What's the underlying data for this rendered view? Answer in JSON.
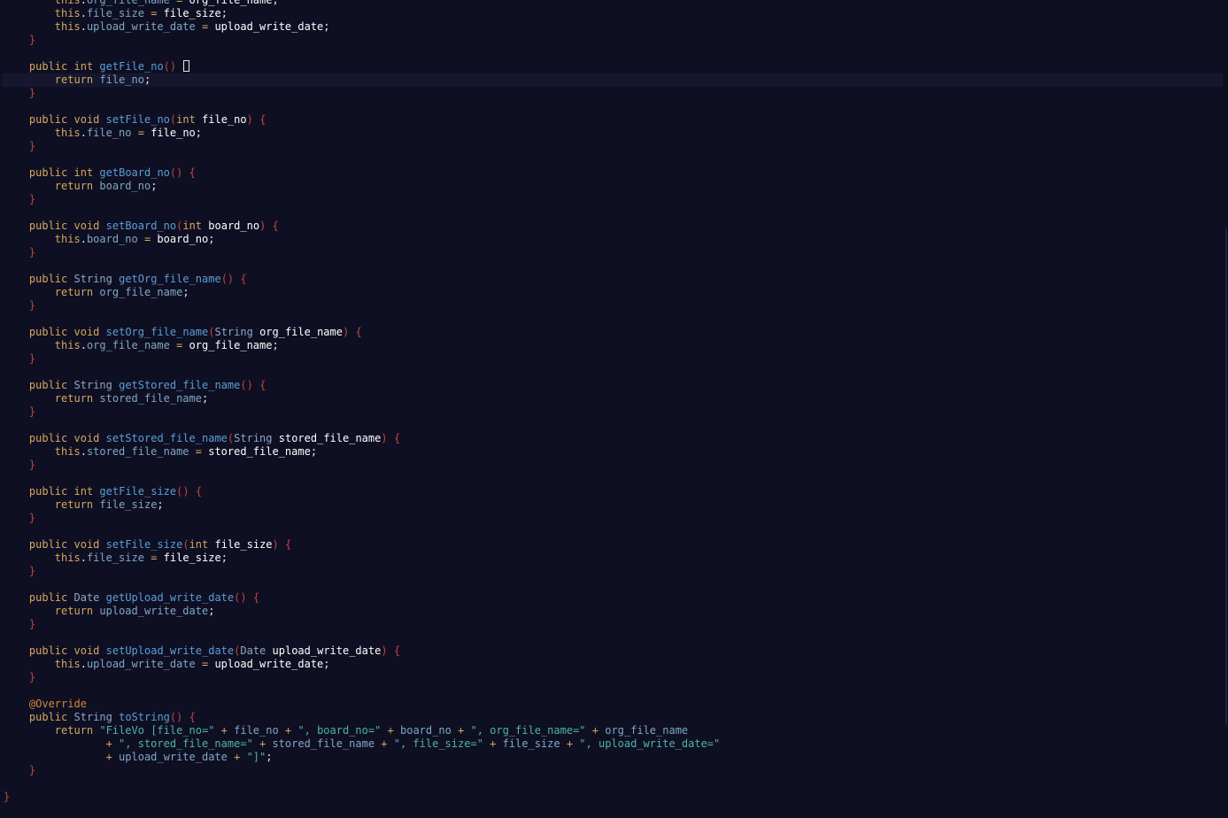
{
  "editor": {
    "theme_colors": {
      "background": "#0f0f23",
      "keyword": "#d4a85c",
      "type": "#8fa6c4",
      "method": "#5a9fd4",
      "field": "#7ea8c6",
      "brace": "#c4453a",
      "annotation": "#d4883c",
      "string": "#4fb3a9"
    },
    "current_line_index": 6,
    "lines": [
      [
        [
          "        ",
          "pl"
        ],
        [
          "this",
          "kw"
        ],
        [
          ".",
          "pl"
        ],
        [
          "org_file_name",
          "fld"
        ],
        [
          " = ",
          "op"
        ],
        [
          "org_file_name",
          "par"
        ],
        [
          ";",
          "pl"
        ]
      ],
      [
        [
          "        ",
          "pl"
        ],
        [
          "this",
          "kw"
        ],
        [
          ".",
          "pl"
        ],
        [
          "file_size",
          "fld"
        ],
        [
          " = ",
          "op"
        ],
        [
          "file_size",
          "par"
        ],
        [
          ";",
          "pl"
        ]
      ],
      [
        [
          "        ",
          "pl"
        ],
        [
          "this",
          "kw"
        ],
        [
          ".",
          "pl"
        ],
        [
          "upload_write_date",
          "fld"
        ],
        [
          " = ",
          "op"
        ],
        [
          "upload_write_date",
          "par"
        ],
        [
          ";",
          "pl"
        ]
      ],
      [
        [
          "    ",
          "pl"
        ],
        [
          "}",
          "brc"
        ]
      ],
      [
        [
          "",
          "pl"
        ]
      ],
      [
        [
          "    ",
          "pl"
        ],
        [
          "public",
          "kw"
        ],
        [
          " ",
          "pl"
        ],
        [
          "int",
          "kw"
        ],
        [
          " ",
          "pl"
        ],
        [
          "getFile_no",
          "fn"
        ],
        [
          "()",
          "brc"
        ],
        [
          " ",
          "pl"
        ],
        [
          "{CARET}",
          "caret"
        ]
      ],
      [
        [
          "        ",
          "pl"
        ],
        [
          "return",
          "kw"
        ],
        [
          " ",
          "pl"
        ],
        [
          "file_no",
          "fld"
        ],
        [
          ";",
          "pl"
        ]
      ],
      [
        [
          "    ",
          "pl"
        ],
        [
          "}",
          "brc"
        ]
      ],
      [
        [
          "",
          "pl"
        ]
      ],
      [
        [
          "    ",
          "pl"
        ],
        [
          "public",
          "kw"
        ],
        [
          " ",
          "pl"
        ],
        [
          "void",
          "kw"
        ],
        [
          " ",
          "pl"
        ],
        [
          "setFile_no",
          "fn"
        ],
        [
          "(",
          "brc"
        ],
        [
          "int",
          "kw"
        ],
        [
          " ",
          "pl"
        ],
        [
          "file_no",
          "par"
        ],
        [
          ")",
          "brc"
        ],
        [
          " ",
          "pl"
        ],
        [
          "{",
          "brc"
        ]
      ],
      [
        [
          "        ",
          "pl"
        ],
        [
          "this",
          "kw"
        ],
        [
          ".",
          "pl"
        ],
        [
          "file_no",
          "fld"
        ],
        [
          " = ",
          "op"
        ],
        [
          "file_no",
          "par"
        ],
        [
          ";",
          "pl"
        ]
      ],
      [
        [
          "    ",
          "pl"
        ],
        [
          "}",
          "brc"
        ]
      ],
      [
        [
          "",
          "pl"
        ]
      ],
      [
        [
          "    ",
          "pl"
        ],
        [
          "public",
          "kw"
        ],
        [
          " ",
          "pl"
        ],
        [
          "int",
          "kw"
        ],
        [
          " ",
          "pl"
        ],
        [
          "getBoard_no",
          "fn"
        ],
        [
          "()",
          "brc"
        ],
        [
          " ",
          "pl"
        ],
        [
          "{",
          "brc"
        ]
      ],
      [
        [
          "        ",
          "pl"
        ],
        [
          "return",
          "kw"
        ],
        [
          " ",
          "pl"
        ],
        [
          "board_no",
          "fld"
        ],
        [
          ";",
          "pl"
        ]
      ],
      [
        [
          "    ",
          "pl"
        ],
        [
          "}",
          "brc"
        ]
      ],
      [
        [
          "",
          "pl"
        ]
      ],
      [
        [
          "    ",
          "pl"
        ],
        [
          "public",
          "kw"
        ],
        [
          " ",
          "pl"
        ],
        [
          "void",
          "kw"
        ],
        [
          " ",
          "pl"
        ],
        [
          "setBoard_no",
          "fn"
        ],
        [
          "(",
          "brc"
        ],
        [
          "int",
          "kw"
        ],
        [
          " ",
          "pl"
        ],
        [
          "board_no",
          "par"
        ],
        [
          ")",
          "brc"
        ],
        [
          " ",
          "pl"
        ],
        [
          "{",
          "brc"
        ]
      ],
      [
        [
          "        ",
          "pl"
        ],
        [
          "this",
          "kw"
        ],
        [
          ".",
          "pl"
        ],
        [
          "board_no",
          "fld"
        ],
        [
          " = ",
          "op"
        ],
        [
          "board_no",
          "par"
        ],
        [
          ";",
          "pl"
        ]
      ],
      [
        [
          "    ",
          "pl"
        ],
        [
          "}",
          "brc"
        ]
      ],
      [
        [
          "",
          "pl"
        ]
      ],
      [
        [
          "    ",
          "pl"
        ],
        [
          "public",
          "kw"
        ],
        [
          " ",
          "pl"
        ],
        [
          "String",
          "ty"
        ],
        [
          " ",
          "pl"
        ],
        [
          "getOrg_file_name",
          "fn"
        ],
        [
          "()",
          "brc"
        ],
        [
          " ",
          "pl"
        ],
        [
          "{",
          "brc"
        ]
      ],
      [
        [
          "        ",
          "pl"
        ],
        [
          "return",
          "kw"
        ],
        [
          " ",
          "pl"
        ],
        [
          "org_file_name",
          "fld"
        ],
        [
          ";",
          "pl"
        ]
      ],
      [
        [
          "    ",
          "pl"
        ],
        [
          "}",
          "brc"
        ]
      ],
      [
        [
          "",
          "pl"
        ]
      ],
      [
        [
          "    ",
          "pl"
        ],
        [
          "public",
          "kw"
        ],
        [
          " ",
          "pl"
        ],
        [
          "void",
          "kw"
        ],
        [
          " ",
          "pl"
        ],
        [
          "setOrg_file_name",
          "fn"
        ],
        [
          "(",
          "brc"
        ],
        [
          "String",
          "ty"
        ],
        [
          " ",
          "pl"
        ],
        [
          "org_file_name",
          "par"
        ],
        [
          ")",
          "brc"
        ],
        [
          " ",
          "pl"
        ],
        [
          "{",
          "brc"
        ]
      ],
      [
        [
          "        ",
          "pl"
        ],
        [
          "this",
          "kw"
        ],
        [
          ".",
          "pl"
        ],
        [
          "org_file_name",
          "fld"
        ],
        [
          " = ",
          "op"
        ],
        [
          "org_file_name",
          "par"
        ],
        [
          ";",
          "pl"
        ]
      ],
      [
        [
          "    ",
          "pl"
        ],
        [
          "}",
          "brc"
        ]
      ],
      [
        [
          "",
          "pl"
        ]
      ],
      [
        [
          "    ",
          "pl"
        ],
        [
          "public",
          "kw"
        ],
        [
          " ",
          "pl"
        ],
        [
          "String",
          "ty"
        ],
        [
          " ",
          "pl"
        ],
        [
          "getStored_file_name",
          "fn"
        ],
        [
          "()",
          "brc"
        ],
        [
          " ",
          "pl"
        ],
        [
          "{",
          "brc"
        ]
      ],
      [
        [
          "        ",
          "pl"
        ],
        [
          "return",
          "kw"
        ],
        [
          " ",
          "pl"
        ],
        [
          "stored_file_name",
          "fld"
        ],
        [
          ";",
          "pl"
        ]
      ],
      [
        [
          "    ",
          "pl"
        ],
        [
          "}",
          "brc"
        ]
      ],
      [
        [
          "",
          "pl"
        ]
      ],
      [
        [
          "    ",
          "pl"
        ],
        [
          "public",
          "kw"
        ],
        [
          " ",
          "pl"
        ],
        [
          "void",
          "kw"
        ],
        [
          " ",
          "pl"
        ],
        [
          "setStored_file_name",
          "fn"
        ],
        [
          "(",
          "brc"
        ],
        [
          "String",
          "ty"
        ],
        [
          " ",
          "pl"
        ],
        [
          "stored_file_name",
          "par"
        ],
        [
          ")",
          "brc"
        ],
        [
          " ",
          "pl"
        ],
        [
          "{",
          "brc"
        ]
      ],
      [
        [
          "        ",
          "pl"
        ],
        [
          "this",
          "kw"
        ],
        [
          ".",
          "pl"
        ],
        [
          "stored_file_name",
          "fld"
        ],
        [
          " = ",
          "op"
        ],
        [
          "stored_file_name",
          "par"
        ],
        [
          ";",
          "pl"
        ]
      ],
      [
        [
          "    ",
          "pl"
        ],
        [
          "}",
          "brc"
        ]
      ],
      [
        [
          "",
          "pl"
        ]
      ],
      [
        [
          "    ",
          "pl"
        ],
        [
          "public",
          "kw"
        ],
        [
          " ",
          "pl"
        ],
        [
          "int",
          "kw"
        ],
        [
          " ",
          "pl"
        ],
        [
          "getFile_size",
          "fn"
        ],
        [
          "()",
          "brc"
        ],
        [
          " ",
          "pl"
        ],
        [
          "{",
          "brc"
        ]
      ],
      [
        [
          "        ",
          "pl"
        ],
        [
          "return",
          "kw"
        ],
        [
          " ",
          "pl"
        ],
        [
          "file_size",
          "fld"
        ],
        [
          ";",
          "pl"
        ]
      ],
      [
        [
          "    ",
          "pl"
        ],
        [
          "}",
          "brc"
        ]
      ],
      [
        [
          "",
          "pl"
        ]
      ],
      [
        [
          "    ",
          "pl"
        ],
        [
          "public",
          "kw"
        ],
        [
          " ",
          "pl"
        ],
        [
          "void",
          "kw"
        ],
        [
          " ",
          "pl"
        ],
        [
          "setFile_size",
          "fn"
        ],
        [
          "(",
          "brc"
        ],
        [
          "int",
          "kw"
        ],
        [
          " ",
          "pl"
        ],
        [
          "file_size",
          "par"
        ],
        [
          ")",
          "brc"
        ],
        [
          " ",
          "pl"
        ],
        [
          "{",
          "brc"
        ]
      ],
      [
        [
          "        ",
          "pl"
        ],
        [
          "this",
          "kw"
        ],
        [
          ".",
          "pl"
        ],
        [
          "file_size",
          "fld"
        ],
        [
          " = ",
          "op"
        ],
        [
          "file_size",
          "par"
        ],
        [
          ";",
          "pl"
        ]
      ],
      [
        [
          "    ",
          "pl"
        ],
        [
          "}",
          "brc"
        ]
      ],
      [
        [
          "",
          "pl"
        ]
      ],
      [
        [
          "    ",
          "pl"
        ],
        [
          "public",
          "kw"
        ],
        [
          " ",
          "pl"
        ],
        [
          "Date",
          "ty"
        ],
        [
          " ",
          "pl"
        ],
        [
          "getUpload_write_date",
          "fn"
        ],
        [
          "()",
          "brc"
        ],
        [
          " ",
          "pl"
        ],
        [
          "{",
          "brc"
        ]
      ],
      [
        [
          "        ",
          "pl"
        ],
        [
          "return",
          "kw"
        ],
        [
          " ",
          "pl"
        ],
        [
          "upload_write_date",
          "fld"
        ],
        [
          ";",
          "pl"
        ]
      ],
      [
        [
          "    ",
          "pl"
        ],
        [
          "}",
          "brc"
        ]
      ],
      [
        [
          "",
          "pl"
        ]
      ],
      [
        [
          "    ",
          "pl"
        ],
        [
          "public",
          "kw"
        ],
        [
          " ",
          "pl"
        ],
        [
          "void",
          "kw"
        ],
        [
          " ",
          "pl"
        ],
        [
          "setUpload_write_date",
          "fn"
        ],
        [
          "(",
          "brc"
        ],
        [
          "Date",
          "ty"
        ],
        [
          " ",
          "pl"
        ],
        [
          "upload_write_date",
          "par"
        ],
        [
          ")",
          "brc"
        ],
        [
          " ",
          "pl"
        ],
        [
          "{",
          "brc"
        ]
      ],
      [
        [
          "        ",
          "pl"
        ],
        [
          "this",
          "kw"
        ],
        [
          ".",
          "pl"
        ],
        [
          "upload_write_date",
          "fld"
        ],
        [
          " = ",
          "op"
        ],
        [
          "upload_write_date",
          "par"
        ],
        [
          ";",
          "pl"
        ]
      ],
      [
        [
          "    ",
          "pl"
        ],
        [
          "}",
          "brc"
        ]
      ],
      [
        [
          "",
          "pl"
        ]
      ],
      [
        [
          "    ",
          "pl"
        ],
        [
          "@Override",
          "ann"
        ]
      ],
      [
        [
          "    ",
          "pl"
        ],
        [
          "public",
          "kw"
        ],
        [
          " ",
          "pl"
        ],
        [
          "String",
          "ty"
        ],
        [
          " ",
          "pl"
        ],
        [
          "toString",
          "fn"
        ],
        [
          "()",
          "brc"
        ],
        [
          " ",
          "pl"
        ],
        [
          "{",
          "brc"
        ]
      ],
      [
        [
          "        ",
          "pl"
        ],
        [
          "return",
          "kw"
        ],
        [
          " ",
          "pl"
        ],
        [
          "\"FileVo [file_no=\"",
          "str"
        ],
        [
          " + ",
          "op"
        ],
        [
          "file_no",
          "fld"
        ],
        [
          " + ",
          "op"
        ],
        [
          "\", board_no=\"",
          "str"
        ],
        [
          " + ",
          "op"
        ],
        [
          "board_no",
          "fld"
        ],
        [
          " + ",
          "op"
        ],
        [
          "\", org_file_name=\"",
          "str"
        ],
        [
          " + ",
          "op"
        ],
        [
          "org_file_name",
          "fld"
        ]
      ],
      [
        [
          "                ",
          "pl"
        ],
        [
          "+ ",
          "op"
        ],
        [
          "\", stored_file_name=\"",
          "str"
        ],
        [
          " + ",
          "op"
        ],
        [
          "stored_file_name",
          "fld"
        ],
        [
          " + ",
          "op"
        ],
        [
          "\", file_size=\"",
          "str"
        ],
        [
          " + ",
          "op"
        ],
        [
          "file_size",
          "fld"
        ],
        [
          " + ",
          "op"
        ],
        [
          "\", upload_write_date=\"",
          "str"
        ]
      ],
      [
        [
          "                ",
          "pl"
        ],
        [
          "+ ",
          "op"
        ],
        [
          "upload_write_date",
          "fld"
        ],
        [
          " + ",
          "op"
        ],
        [
          "\"]\"",
          "str"
        ],
        [
          ";",
          "pl"
        ]
      ],
      [
        [
          "    ",
          "pl"
        ],
        [
          "}",
          "brc"
        ]
      ],
      [
        [
          "",
          "pl"
        ]
      ],
      [
        [
          "}",
          "brc"
        ]
      ]
    ]
  }
}
